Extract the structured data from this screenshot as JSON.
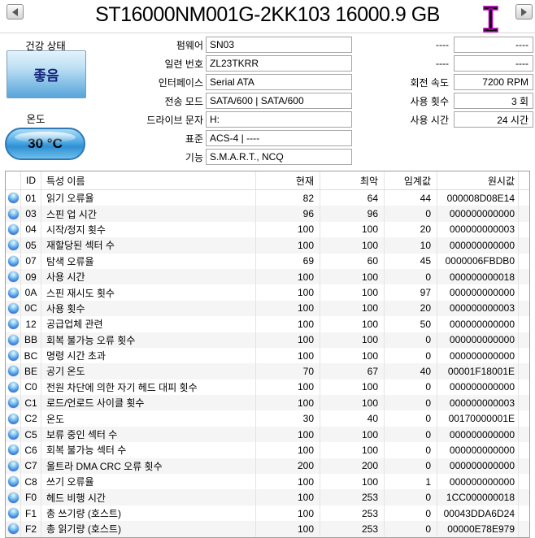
{
  "window": {
    "title": "ST16000NM001G-2KK103 16000.9 GB"
  },
  "nav": {
    "prev_icon": "left-arrow",
    "next_icon": "right-arrow"
  },
  "health": {
    "label": "건강 상태",
    "status": "좋음"
  },
  "temperature": {
    "label": "온도",
    "value": "30 °C"
  },
  "info_fields": [
    {
      "label": "펌웨어",
      "value": "SN03"
    },
    {
      "label": "일련 번호",
      "value": "ZL23TKRR"
    },
    {
      "label": "인터페이스",
      "value": "Serial ATA"
    },
    {
      "label": "전송 모드",
      "value": "SATA/600 | SATA/600"
    },
    {
      "label": "드라이브 문자",
      "value": "H:"
    },
    {
      "label": "표준",
      "value": "ACS-4 | ----"
    },
    {
      "label": "기능",
      "value": "S.M.A.R.T., NCQ"
    }
  ],
  "stat_fields": [
    {
      "label": "----",
      "value": "----"
    },
    {
      "label": "----",
      "value": "----"
    },
    {
      "label": "회전 속도",
      "value": "7200 RPM"
    },
    {
      "label": "사용 횟수",
      "value": "3 회"
    },
    {
      "label": "사용 시간",
      "value": "24 시간"
    }
  ],
  "smart_table": {
    "columns": [
      "",
      "ID",
      "특성 이름",
      "현재",
      "최악",
      "임계값",
      "원시값"
    ],
    "rows": [
      {
        "id": "01",
        "name": "읽기 오류율",
        "current": "82",
        "worst": "64",
        "threshold": "44",
        "raw": "000008D08E14"
      },
      {
        "id": "03",
        "name": "스핀 업 시간",
        "current": "96",
        "worst": "96",
        "threshold": "0",
        "raw": "000000000000"
      },
      {
        "id": "04",
        "name": "시작/정지 횟수",
        "current": "100",
        "worst": "100",
        "threshold": "20",
        "raw": "000000000003"
      },
      {
        "id": "05",
        "name": "재할당된 섹터 수",
        "current": "100",
        "worst": "100",
        "threshold": "10",
        "raw": "000000000000"
      },
      {
        "id": "07",
        "name": "탐색 오류율",
        "current": "69",
        "worst": "60",
        "threshold": "45",
        "raw": "0000006FBDB0"
      },
      {
        "id": "09",
        "name": "사용 시간",
        "current": "100",
        "worst": "100",
        "threshold": "0",
        "raw": "000000000018"
      },
      {
        "id": "0A",
        "name": "스핀 재시도 횟수",
        "current": "100",
        "worst": "100",
        "threshold": "97",
        "raw": "000000000000"
      },
      {
        "id": "0C",
        "name": "사용 횟수",
        "current": "100",
        "worst": "100",
        "threshold": "20",
        "raw": "000000000003"
      },
      {
        "id": "12",
        "name": "공급업체 관련",
        "current": "100",
        "worst": "100",
        "threshold": "50",
        "raw": "000000000000"
      },
      {
        "id": "BB",
        "name": "회복 불가능 오류 횟수",
        "current": "100",
        "worst": "100",
        "threshold": "0",
        "raw": "000000000000"
      },
      {
        "id": "BC",
        "name": "명령 시간 초과",
        "current": "100",
        "worst": "100",
        "threshold": "0",
        "raw": "000000000000"
      },
      {
        "id": "BE",
        "name": "공기 온도",
        "current": "70",
        "worst": "67",
        "threshold": "40",
        "raw": "00001F18001E"
      },
      {
        "id": "C0",
        "name": "전원 차단에 의한 자기 헤드 대피 횟수",
        "current": "100",
        "worst": "100",
        "threshold": "0",
        "raw": "000000000000"
      },
      {
        "id": "C1",
        "name": "로드/언로드 사이클 횟수",
        "current": "100",
        "worst": "100",
        "threshold": "0",
        "raw": "000000000003"
      },
      {
        "id": "C2",
        "name": "온도",
        "current": "30",
        "worst": "40",
        "threshold": "0",
        "raw": "00170000001E"
      },
      {
        "id": "C5",
        "name": "보류 중인 섹터 수",
        "current": "100",
        "worst": "100",
        "threshold": "0",
        "raw": "000000000000"
      },
      {
        "id": "C6",
        "name": "회복 불가능 섹터 수",
        "current": "100",
        "worst": "100",
        "threshold": "0",
        "raw": "000000000000"
      },
      {
        "id": "C7",
        "name": "울트라 DMA CRC 오류 횟수",
        "current": "200",
        "worst": "200",
        "threshold": "0",
        "raw": "000000000000"
      },
      {
        "id": "C8",
        "name": "쓰기 오류율",
        "current": "100",
        "worst": "100",
        "threshold": "1",
        "raw": "000000000000"
      },
      {
        "id": "F0",
        "name": "헤드 비행 시간",
        "current": "100",
        "worst": "253",
        "threshold": "0",
        "raw": "1CC000000018"
      },
      {
        "id": "F1",
        "name": "총 쓰기량 (호스트)",
        "current": "100",
        "worst": "253",
        "threshold": "0",
        "raw": "00043DDA6D24"
      },
      {
        "id": "F2",
        "name": "총 읽기량 (호스트)",
        "current": "100",
        "worst": "253",
        "threshold": "0",
        "raw": "00000E78E979"
      }
    ]
  },
  "colors": {
    "health_good": "#58a5da",
    "health_text": "#16247e",
    "temp_pill": "#2f8fd4",
    "status_orb": "#3e86dc",
    "box_border": "#a6a6a6",
    "table_border": "#a0a0a0",
    "alt_row": "#f5f5f5",
    "cursor_outline": "#c000c0"
  }
}
